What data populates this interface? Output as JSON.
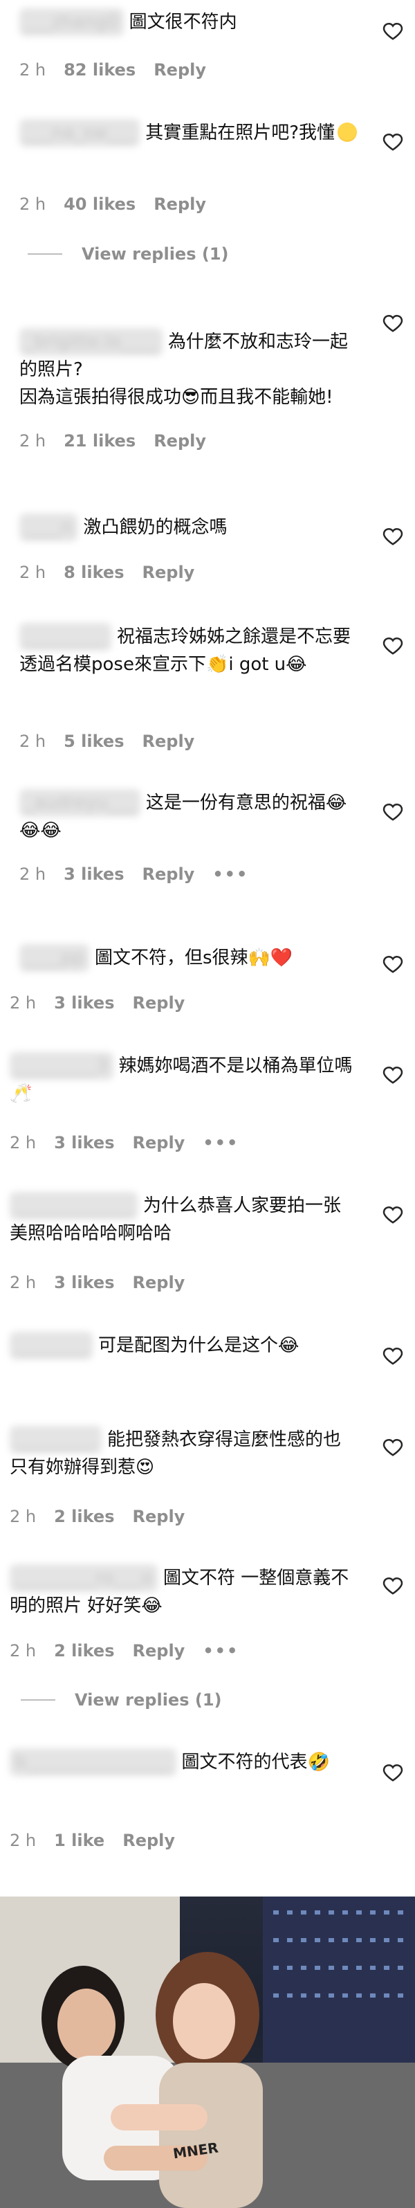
{
  "comments": [
    {
      "user": "___zhang0",
      "text": "圖文很不符内",
      "time": "2 h",
      "likes": "82 likes",
      "reply": "Reply"
    },
    {
      "user": "___na_sw___",
      "text": "其實重點在照片吧?我懂",
      "time": "2 h",
      "likes": "40 likes",
      "reply": "Reply",
      "view_replies": "View replies (1)"
    },
    {
      "user": "_brigitte.lo____",
      "text": "為什麼不放和志玲一起的照片?\n因為這張拍得很成功😎而且我不能輸她!",
      "time": "2 h",
      "likes": "21 likes",
      "reply": "Reply"
    },
    {
      "user": "____n",
      "text": "激凸餵奶的概念嗎",
      "time": "2 h",
      "likes": "8 likes",
      "reply": "Reply"
    },
    {
      "user": "_________",
      "text": "祝福志玲姊姊之餘還是不忘要透過名模pose來宣示下👏i got u😂",
      "time": "2 h",
      "likes": "5 likes",
      "reply": "Reply"
    },
    {
      "user": "_audreyu___",
      "text": "这是一份有意思的祝福😂😂😂",
      "time": "2 h",
      "likes": "3 likes",
      "reply": "Reply",
      "more": "•••"
    },
    {
      "user": "____pp",
      "text": "圖文不符，但s很辣🙌❤️",
      "time": "2 h",
      "likes": "3 likes",
      "reply": "Reply"
    },
    {
      "user": "_________3",
      "text": "辣媽妳喝酒不是以桶為單位嗎🥂",
      "time": "2 h",
      "likes": "3 likes",
      "reply": "Reply",
      "more": "•••"
    },
    {
      "user": "_____________",
      "text": "为什么恭喜人家要拍一张美照哈哈哈哈啊哈哈",
      "time": "2 h",
      "likes": "3 likes",
      "reply": "Reply"
    },
    {
      "user": "________",
      "text": "可是配图为什么是这个😂",
      "time": "",
      "likes": "",
      "reply": ""
    },
    {
      "user": "_________",
      "text": "能把發熱衣穿得這麼性感的也只有妳辦得到惹😍",
      "time": "2 h",
      "likes": "2 likes",
      "reply": "Reply"
    },
    {
      "user": "_________ro___o",
      "text": "圖文不符 一整個意義不明的照片 好好笑😂",
      "time": "2 h",
      "likes": "2 likes",
      "reply": "Reply",
      "more": "•••",
      "view_replies": "View replies (1)"
    },
    {
      "user": "b________________",
      "text": "圖文不符的代表🤣",
      "time": "2 h",
      "likes": "1 like",
      "reply": "Reply"
    }
  ],
  "icons": {
    "heart": "heart-outline-icon",
    "more": "more-dots-icon"
  },
  "photo": {
    "caption_overlay": "MNER"
  }
}
